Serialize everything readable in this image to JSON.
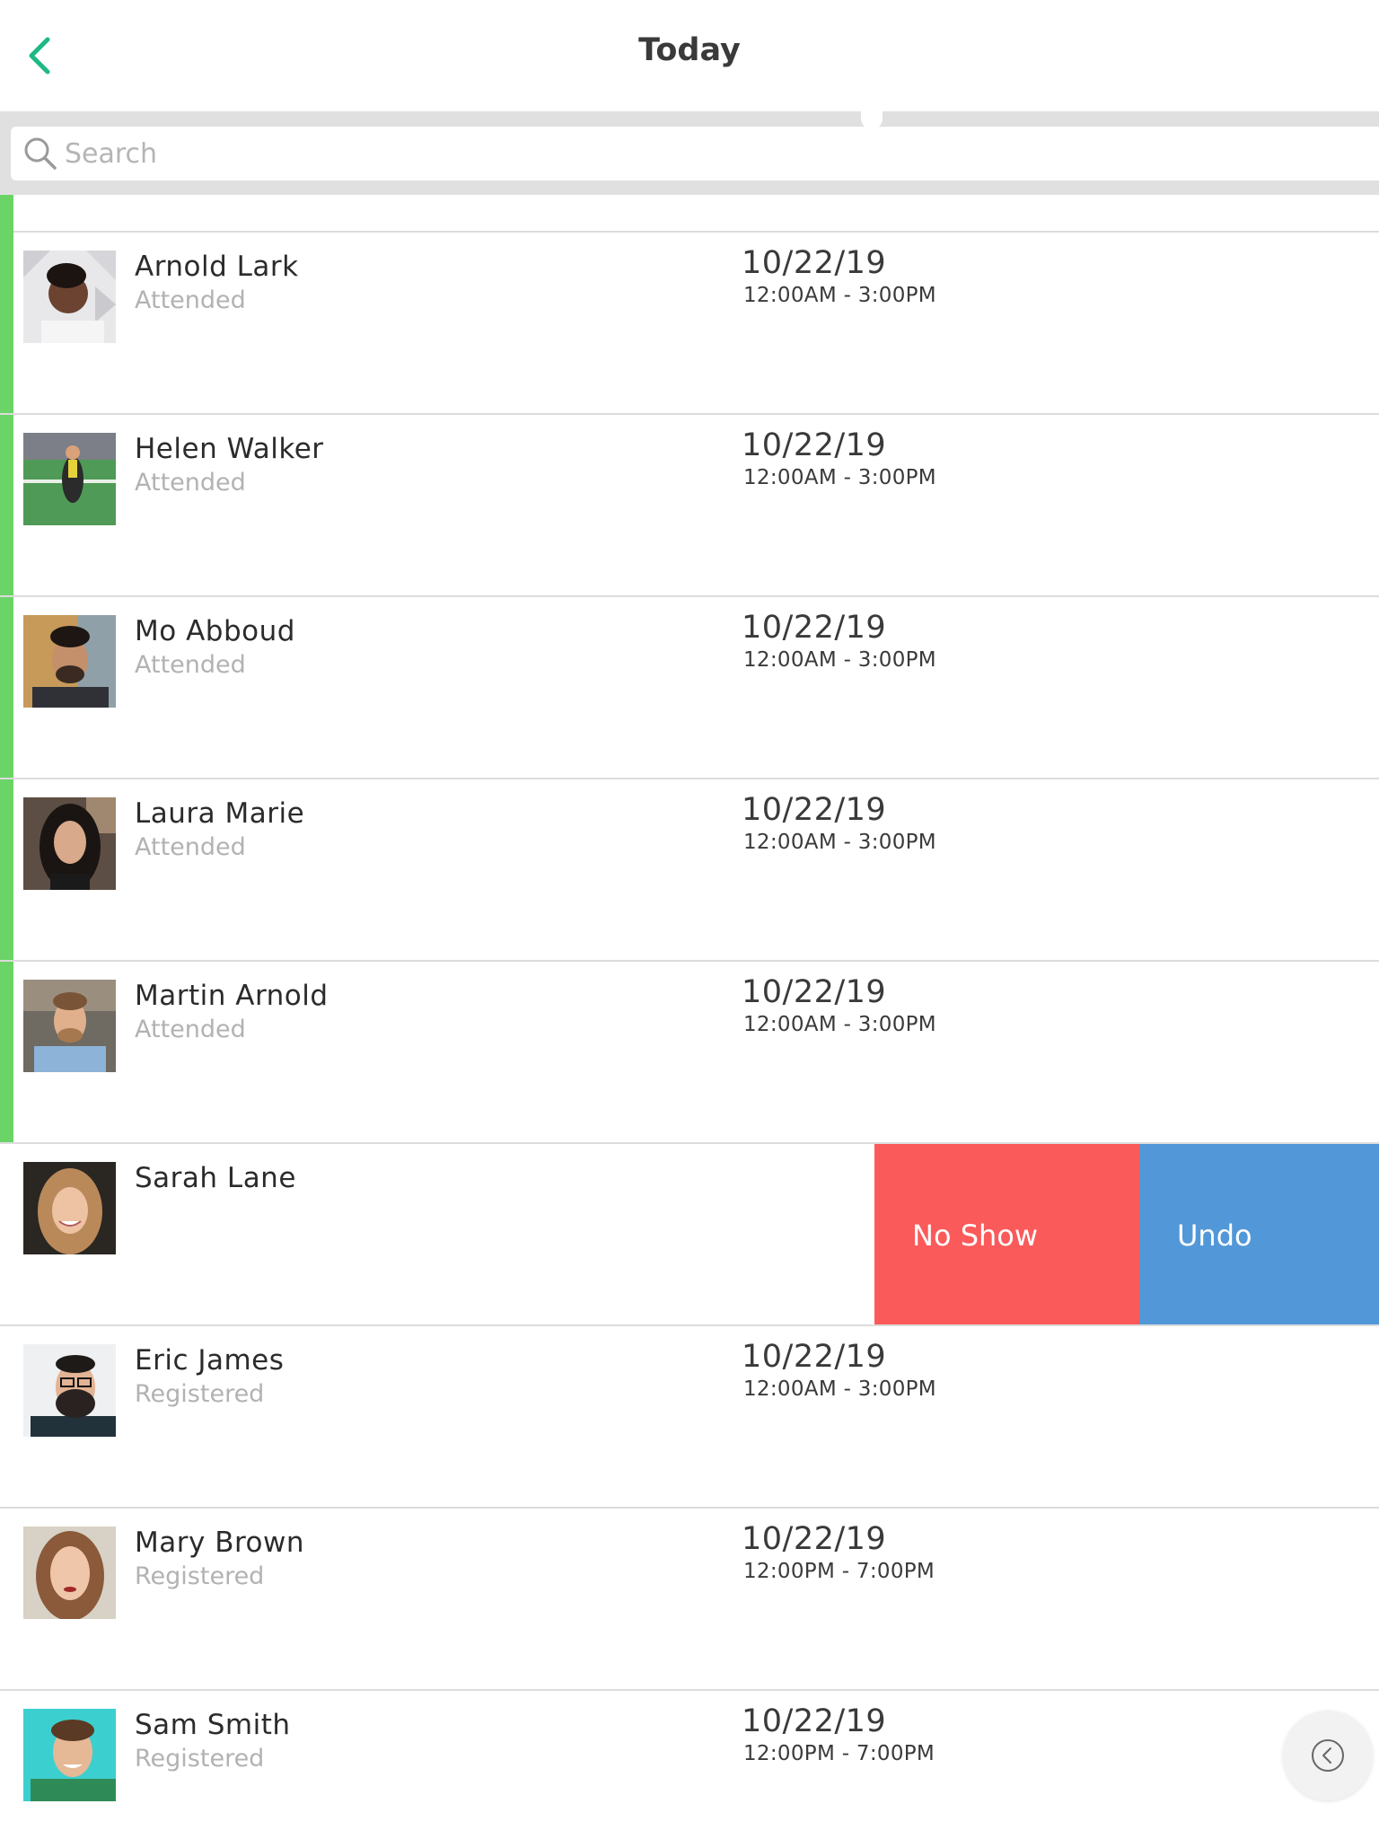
{
  "header": {
    "title": "Today",
    "back_icon": "chevron-left-icon",
    "accent_color": "#1db983"
  },
  "search": {
    "placeholder": "Search",
    "value": ""
  },
  "colors": {
    "attended_bar": "#6ad466",
    "no_show": "#fb5a5a",
    "undo": "#5298d8"
  },
  "rows": [
    {
      "name": "Arnold Lark",
      "status": "Attended",
      "date": "10/22/19",
      "time": "12:00AM - 3:00PM"
    },
    {
      "name": "Helen Walker",
      "status": "Attended",
      "date": "10/22/19",
      "time": "12:00AM - 3:00PM"
    },
    {
      "name": "Mo Abboud",
      "status": "Attended",
      "date": "10/22/19",
      "time": "12:00AM - 3:00PM"
    },
    {
      "name": "Laura Marie",
      "status": "Attended",
      "date": "10/22/19",
      "time": "12:00AM - 3:00PM"
    },
    {
      "name": "Martin Arnold",
      "status": "Attended",
      "date": "10/22/19",
      "time": "12:00AM - 3:00PM"
    },
    {
      "name": "Sarah Lane",
      "status": "",
      "date": "",
      "time": ""
    },
    {
      "name": "Eric James",
      "status": "Registered",
      "date": "10/22/19",
      "time": "12:00AM - 3:00PM"
    },
    {
      "name": "Mary Brown",
      "status": "Registered",
      "date": "10/22/19",
      "time": "12:00PM - 7:00PM"
    },
    {
      "name": "Sam Smith",
      "status": "Registered",
      "date": "10/22/19",
      "time": "12:00PM - 7:00PM"
    }
  ],
  "swipe_actions": {
    "no_show_label": "No Show",
    "undo_label": "Undo"
  },
  "float_button": {
    "icon": "circle-chevron-left-icon"
  }
}
